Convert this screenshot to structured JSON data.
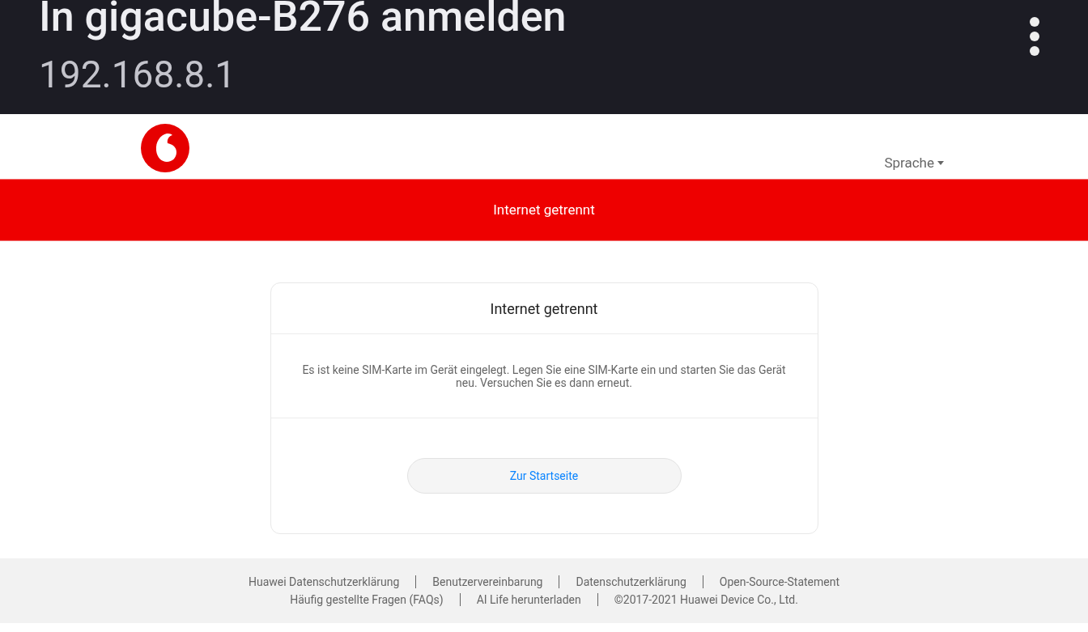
{
  "browser_header": {
    "title": "In gigacube-B276 anmelden",
    "address": "192.168.8.1"
  },
  "top_bar": {
    "language_menu": "Sprache"
  },
  "status_banner": {
    "text": "Internet getrennt"
  },
  "dialog": {
    "title": "Internet getrennt",
    "message": "Es ist keine SIM-Karte im Gerät eingelegt. Legen Sie eine SIM-Karte ein und starten Sie das Gerät neu. Versuchen Sie es dann erneut.",
    "button": "Zur Startseite"
  },
  "footer": {
    "links": [
      "Huawei Datenschutzerklärung",
      "Benutzervereinbarung",
      "Datenschutzerklärung",
      "Open-Source-Statement",
      "Häufig gestellte Fragen (FAQs)",
      "AI Life herunterladen"
    ],
    "copyright": "©2017-2021 Huawei Device Co., Ltd."
  }
}
